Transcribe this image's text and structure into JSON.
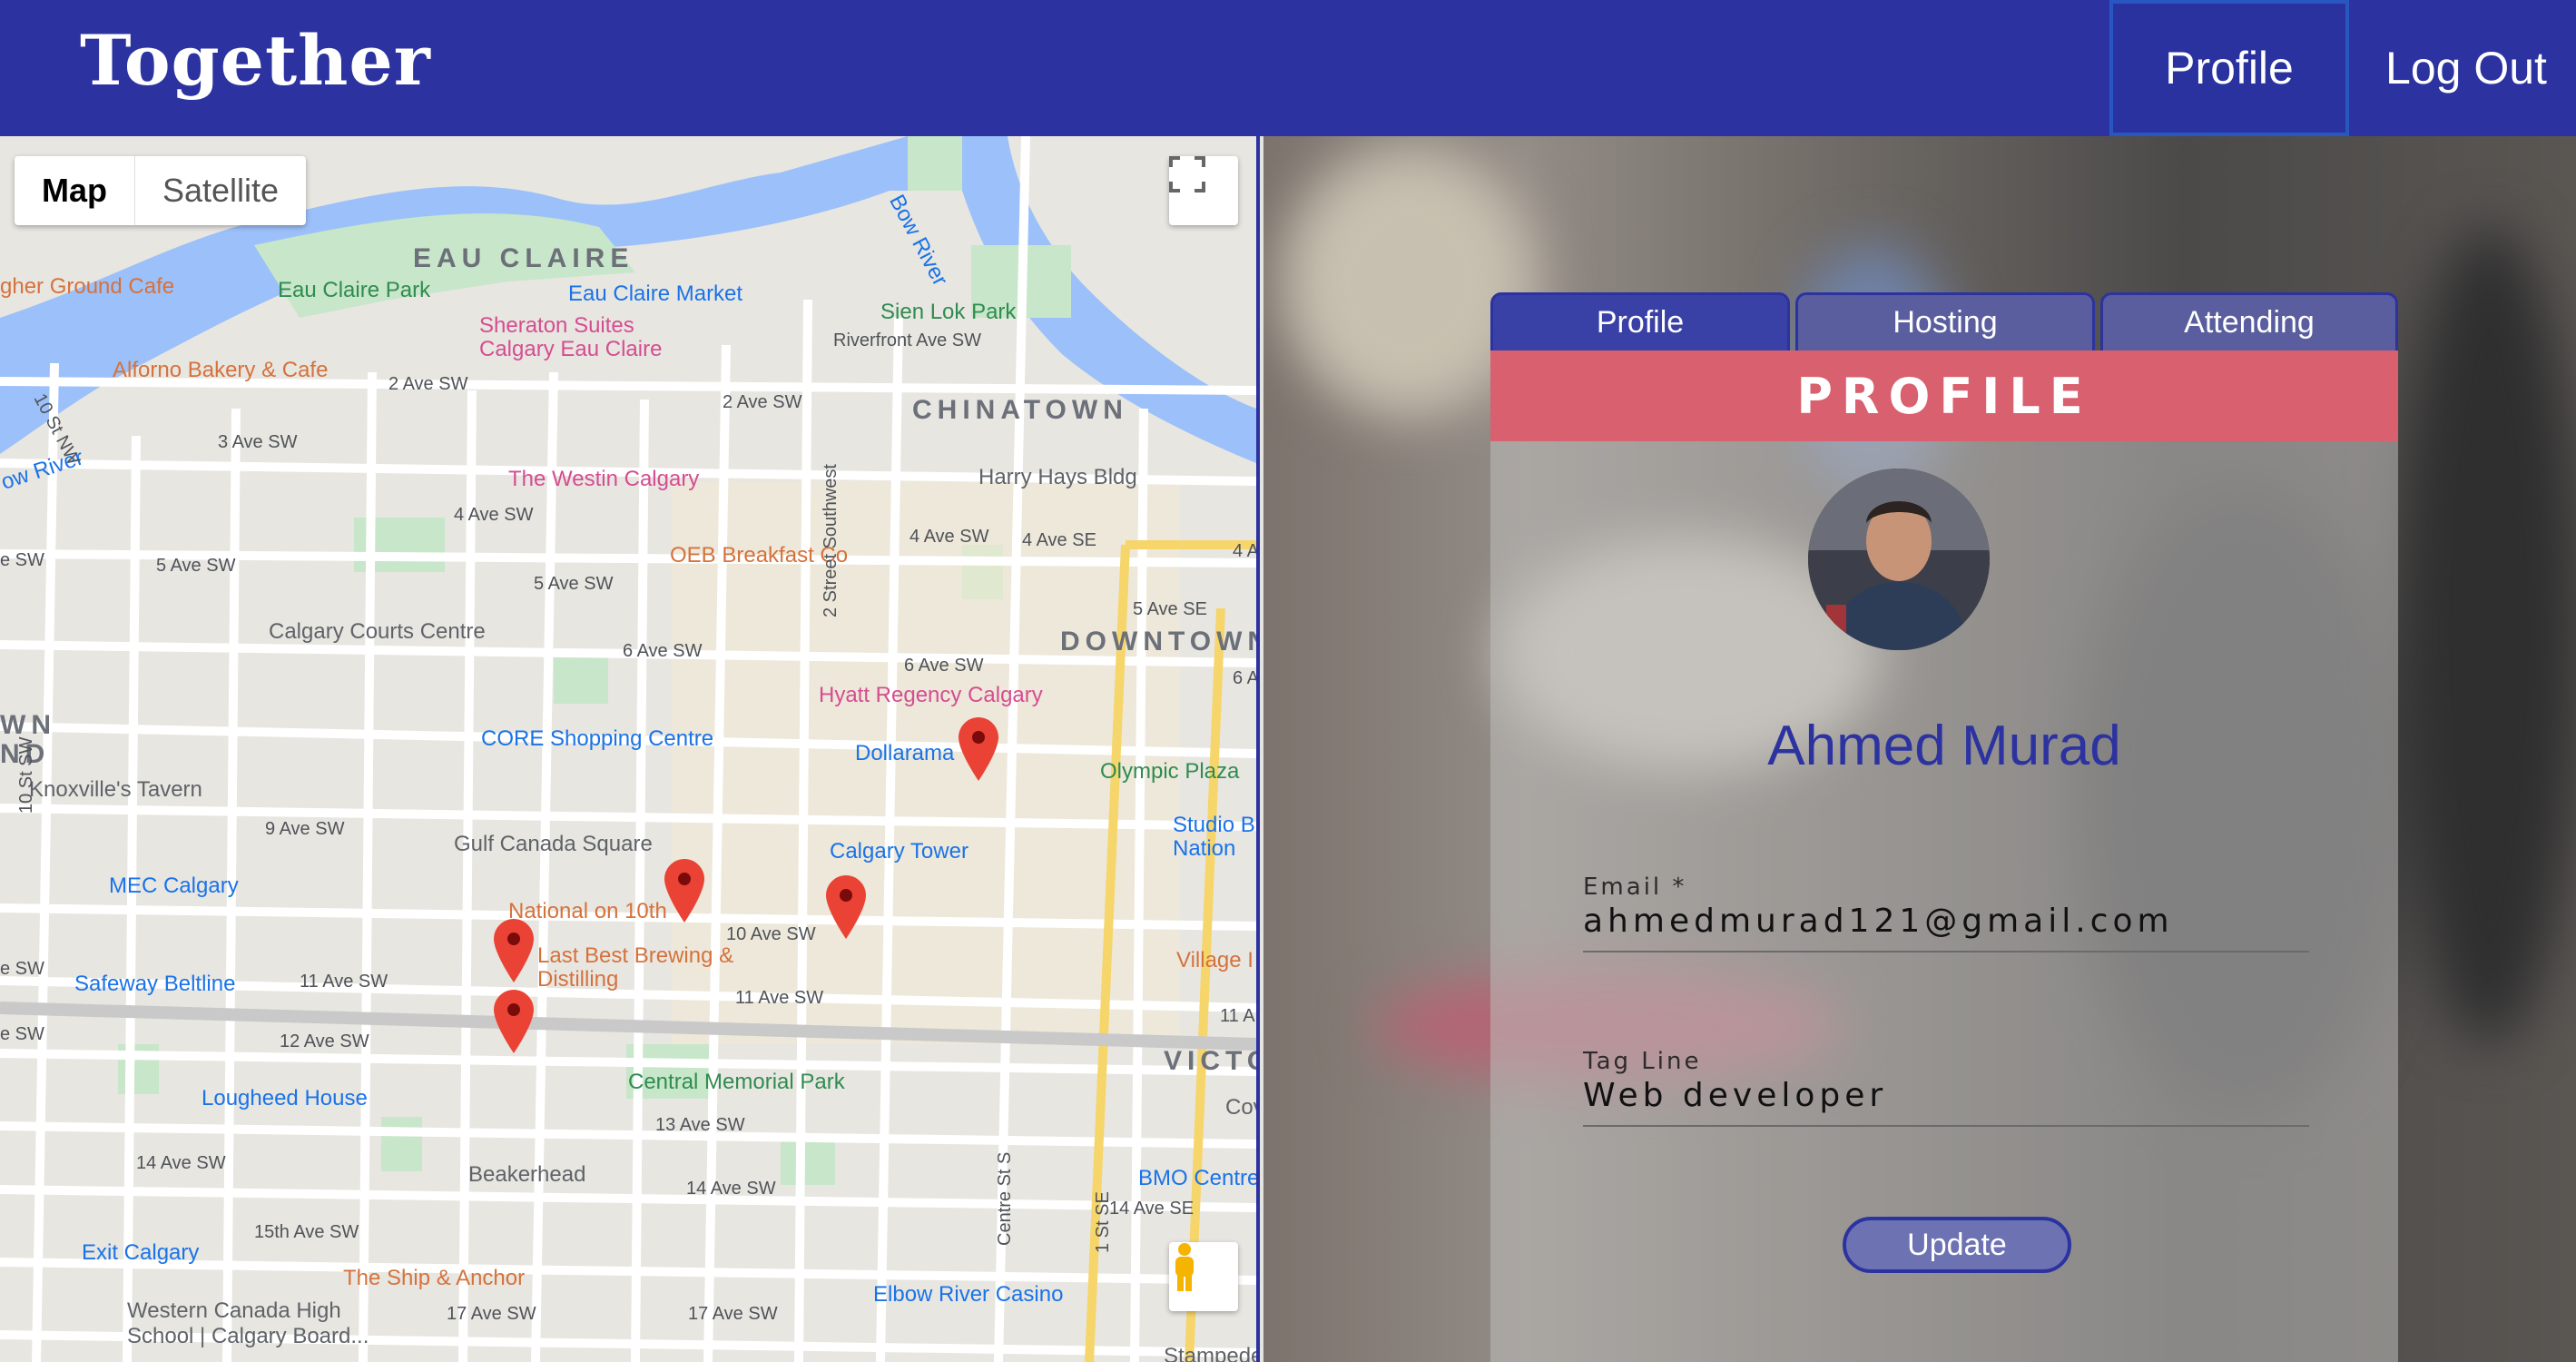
{
  "header": {
    "logo_text": "Together",
    "nav": {
      "profile": "Profile",
      "logout": "Log Out"
    },
    "color": "#2c33a0"
  },
  "map": {
    "type_control": {
      "map": "Map",
      "satellite": "Satellite"
    },
    "districts": [
      "EAU CLAIRE",
      "CHINATOWN",
      "DOWNTOWN",
      "WN",
      "ND",
      "VICTO"
    ],
    "places": {
      "ground_cafe": "gher Ground Cafe",
      "eau_claire_park": "Eau Claire Park",
      "eau_claire_market": "Eau Claire Market",
      "sien_lok_park": "Sien Lok Park",
      "sheraton": "Sheraton Suites Calgary Eau Claire",
      "alforno": "Alforno Bakery & Cafe",
      "westin": "The Westin Calgary",
      "harry_hays": "Harry Hays Bldg",
      "oeb": "OEB Breakfast Co",
      "courts": "Calgary Courts Centre",
      "hyatt": "Hyatt Regency Calgary",
      "core": "CORE Shopping Centre",
      "dollarama": "Dollarama",
      "olympic_plaza": "Olympic Plaza",
      "knoxville": "Knoxville's Tavern",
      "gulf_canada": "Gulf Canada Square",
      "calgary_tower": "Calgary Tower",
      "studio_bell": "Studio B Nation",
      "mec": "MEC Calgary",
      "national": "National on 10th",
      "last_best": "Last Best Brewing & Distilling",
      "village": "Village I",
      "safeway": "Safeway Beltline",
      "lougheed": "Lougheed House",
      "central_memorial": "Central Memorial Park",
      "beakerhead": "Beakerhead",
      "bmo": "BMO Centre",
      "exit_calgary": "Exit Calgary",
      "ship_anchor": "The Ship & Anchor",
      "elbow_river": "Elbow River Casino",
      "western_canada": "Western Canada High School | Calgary Board...",
      "bow_river": "Bow River",
      "cov": "Cov",
      "stampede": "Stampede",
      "ow_river": "ow River"
    },
    "streets": {
      "riverfront": "Riverfront Ave SW",
      "s2_ave": "2 Ave SW",
      "s2_ave_b": "2 Ave SW",
      "s3_ave": "3 Ave SW",
      "s4_ave": "4 Ave SW",
      "s4_ave_b": "4 Ave SW",
      "s4_ave_se": "4 Ave SE",
      "s5_ave": "5 Ave SW",
      "s5_ave_b": "5 Ave SW",
      "s5_ave_se": "5 Ave SE",
      "s6_ave": "6 Ave SW",
      "s6_ave_b": "6 Ave SW",
      "s9_ave": "9 Ave SW",
      "s10_ave": "10 Ave SW",
      "s11_ave": "11 Ave SW",
      "s11_ave_b": "11 Ave SW",
      "s12_ave": "12 Ave SW",
      "s13_ave": "13 Ave SW",
      "s14_ave": "14 Ave SW",
      "s14_ave_b": "14 Ave SW",
      "s14_ave_se": "14 Ave SE",
      "s15_ave": "15th Ave SW",
      "s17_ave": "17 Ave SW",
      "s17_ave_b": "17 Ave SW",
      "tenth_nw": "10 St NW",
      "second_sw": "2 Street Southwest",
      "first_se": "1 St SE",
      "centre_st": "Centre St S",
      "ten_st": "10 St SW",
      "sw_e": "e SW",
      "sw_e2": "e SW",
      "sw_e3": "e SW",
      "four_a": "4 A",
      "six_a": "6 A",
      "eleven_a": "11 A"
    }
  },
  "card": {
    "tabs": {
      "profile": "Profile",
      "hosting": "Hosting",
      "attending": "Attending"
    },
    "title": "PROFILE",
    "title_color": "#d9606f",
    "name": "Ahmed Murad",
    "email_label": "Email *",
    "email_value": "ahmedmurad121@gmail.com",
    "tagline_label": "Tag Line",
    "tagline_value": "Web developer",
    "update_button": "Update"
  }
}
